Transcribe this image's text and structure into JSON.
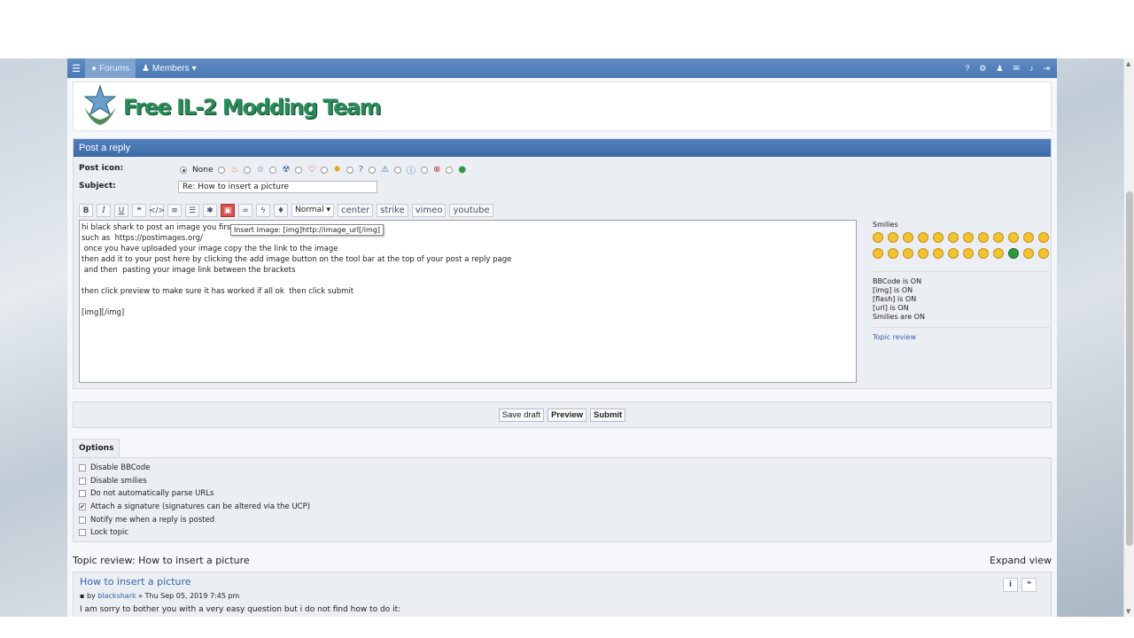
{
  "nav": {
    "tab_forums": "Forums",
    "tab_members": "Members"
  },
  "logo": {
    "text": "Free IL-2 Modding Team"
  },
  "post": {
    "heading": "Post a reply",
    "icon_label": "Post icon:",
    "icon_none": "None",
    "subject_label": "Subject:",
    "subject_value": "Re: How to insert a picture",
    "font_size_select": "Normal",
    "toolbar_words": [
      "center",
      "strike",
      "vimeo",
      "youtube"
    ],
    "tooltip": "Insert image: [img]http://image_url[/img]",
    "message_lines": [
      "hi black shark to post an image you first ne",
      "such as  https://postimages.org/",
      " once you have uploaded your image copy the the link to the image",
      "then add it to your post here by clicking the add image button on the tool bar at the top of your post a reply page",
      " and then  pasting your image link between the brackets",
      "",
      "then click preview to make sure it has worked if all ok  then click submit",
      "",
      "[img][/img]"
    ]
  },
  "smilies": {
    "title": "Smilies",
    "status": [
      "BBCode is ON",
      "[img] is ON",
      "[flash] is ON",
      "[url] is ON",
      "Smilies are ON"
    ],
    "topic_review_link": "Topic review"
  },
  "buttons": {
    "save_draft": "Save draft",
    "preview": "Preview",
    "submit": "Submit"
  },
  "options": {
    "tab": "Options",
    "items": [
      {
        "label": "Disable BBCode",
        "checked": false
      },
      {
        "label": "Disable smilies",
        "checked": false
      },
      {
        "label": "Do not automatically parse URLs",
        "checked": false
      },
      {
        "label": "Attach a signature (signatures can be altered via the UCP)",
        "checked": true
      },
      {
        "label": "Notify me when a reply is posted",
        "checked": false
      },
      {
        "label": "Lock topic",
        "checked": false
      }
    ]
  },
  "review": {
    "heading": "Topic review: How to insert a picture",
    "expand": "Expand view",
    "post_title": "How to insert a picture",
    "by": "by",
    "author": "blackshark",
    "date": "» Thu Sep 05, 2019 7:45 pm",
    "body": "I am sorry to bother you with a very easy question but i do not find how to do it:"
  }
}
